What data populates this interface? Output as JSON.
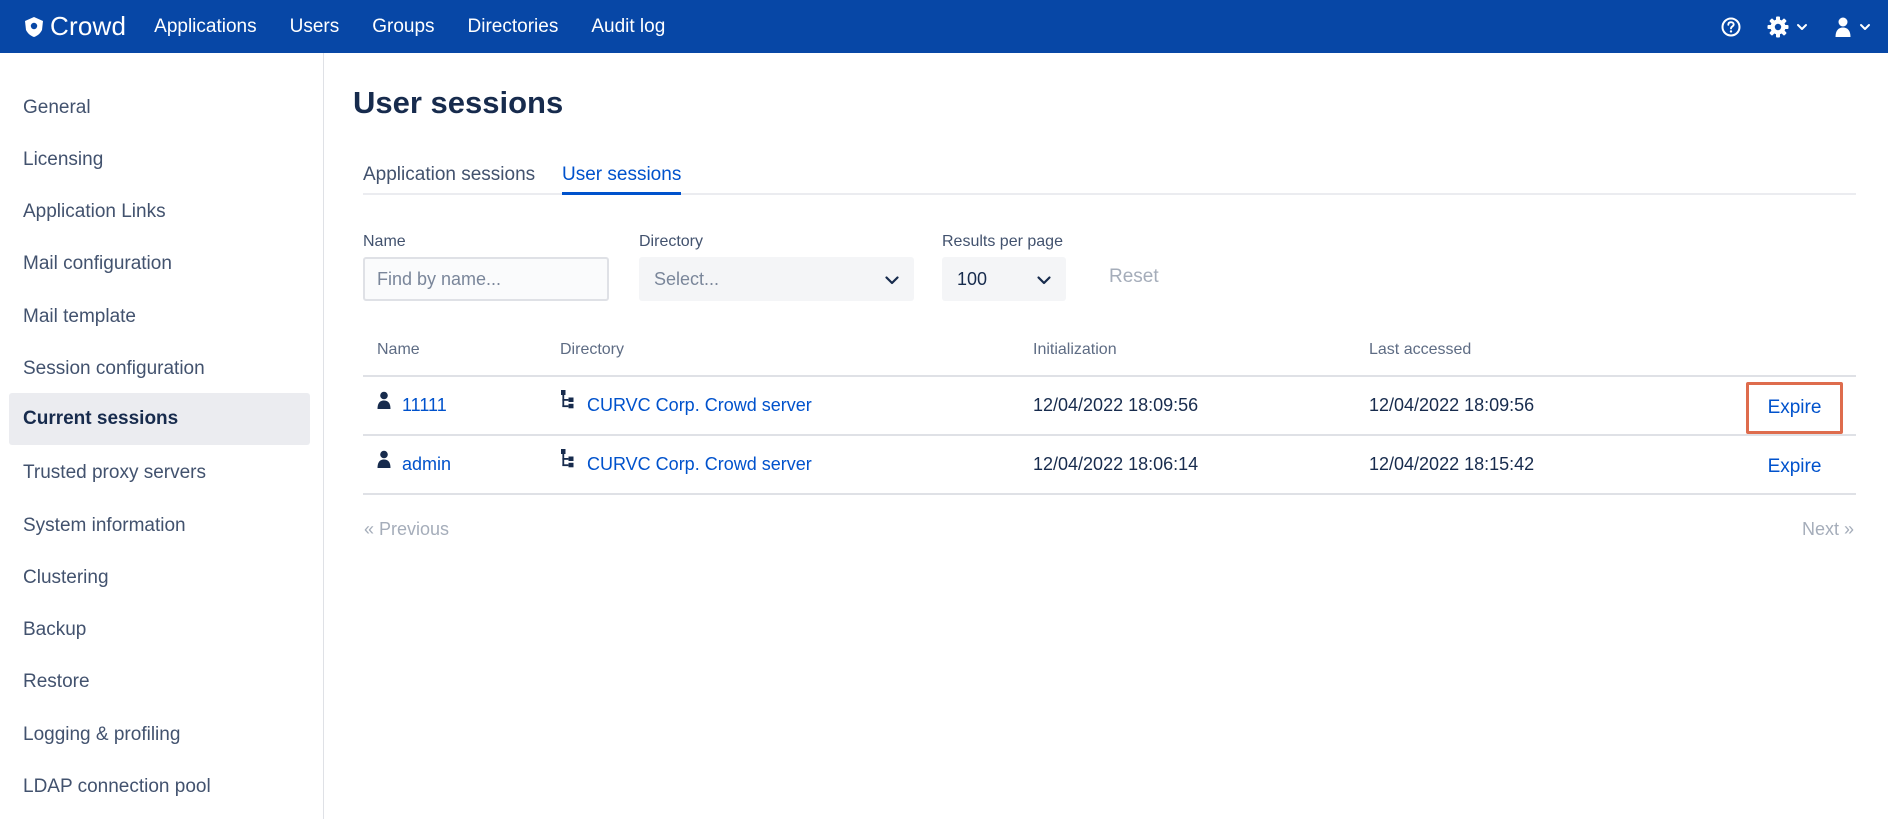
{
  "app": {
    "name": "Crowd",
    "icon": "crowd-logo-icon"
  },
  "topnav": [
    "Applications",
    "Users",
    "Groups",
    "Directories",
    "Audit log"
  ],
  "topright": {
    "help_icon": "help-icon",
    "settings_icon": "gear-icon",
    "user_icon": "user-icon"
  },
  "sidebar": {
    "items": [
      "General",
      "Licensing",
      "Application Links",
      "Mail configuration",
      "Mail template",
      "Session configuration",
      "Current sessions",
      "Trusted proxy servers",
      "System information",
      "Clustering",
      "Backup",
      "Restore",
      "Logging & profiling",
      "LDAP connection pool"
    ],
    "active": "Current sessions"
  },
  "page": {
    "title": "User sessions"
  },
  "tabs": {
    "application": "Application sessions",
    "user": "User sessions",
    "active": "User sessions"
  },
  "filters": {
    "name_label": "Name",
    "name_placeholder": "Find by name...",
    "directory_label": "Directory",
    "directory_placeholder": "Select...",
    "results_label": "Results per page",
    "results_value": "100",
    "reset": "Reset"
  },
  "table": {
    "headers": [
      "Name",
      "Directory",
      "Initialization",
      "Last accessed"
    ],
    "rows": [
      {
        "name": "11111",
        "directory": "CURVC Corp. Crowd server",
        "initialization": "12/04/2022 18:09:56",
        "last_accessed": "12/04/2022 18:09:56",
        "action": "Expire",
        "highlighted": true
      },
      {
        "name": "admin",
        "directory": "CURVC Corp. Crowd server",
        "initialization": "12/04/2022 18:06:14",
        "last_accessed": "12/04/2022 18:15:42",
        "action": "Expire",
        "highlighted": false
      }
    ]
  },
  "pagination": {
    "previous": "« Previous",
    "next": "Next »"
  },
  "colors": {
    "topbar": "#0747a6",
    "link": "#0052cc",
    "highlight": "#de6c4d"
  }
}
